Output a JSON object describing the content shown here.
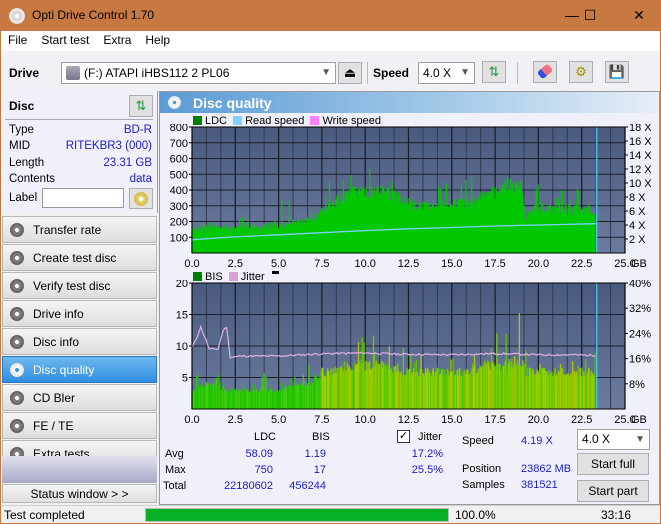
{
  "window": {
    "title": "Opti Drive Control 1.70",
    "minimize": "—",
    "maximize": "☐",
    "close": "✕"
  },
  "menu": [
    "File",
    "Start test",
    "Extra",
    "Help"
  ],
  "toolbar": {
    "drive_label": "Drive",
    "drive_value": "(F:)  ATAPI iHBS112  2 PL06",
    "speed_label": "Speed",
    "speed_value": "4.0 X",
    "icons": [
      "eject-icon",
      "refresh-icon",
      "erase-icon",
      "settings-icon",
      "save-icon"
    ]
  },
  "disc": {
    "header": "Disc",
    "type_label": "Type",
    "type_value": "BD-R",
    "mid_label": "MID",
    "mid_value": "RITEKBR3 (000)",
    "length_label": "Length",
    "length_value": "23.31 GB",
    "contents_label": "Contents",
    "contents_value": "data",
    "label_label": "Label",
    "label_value": ""
  },
  "nav": [
    {
      "label": "Transfer rate",
      "active": false
    },
    {
      "label": "Create test disc",
      "active": false
    },
    {
      "label": "Verify test disc",
      "active": false
    },
    {
      "label": "Drive info",
      "active": false
    },
    {
      "label": "Disc info",
      "active": false
    },
    {
      "label": "Disc quality",
      "active": true
    },
    {
      "label": "CD Bler",
      "active": false
    },
    {
      "label": "FE / TE",
      "active": false
    },
    {
      "label": "Extra tests",
      "active": false
    }
  ],
  "status_window_button": "Status window > >",
  "panel_title": "Disc quality",
  "colors": {
    "ldc": "#00c800",
    "read_speed": "#7fd0ff",
    "write_speed": "#ff80ff",
    "bis": "#00a000",
    "jitter": "#d8a0d8",
    "plot_bg": "#5a6a8a",
    "accent": "#2f8fe0"
  },
  "chart_data": [
    {
      "type": "area",
      "title": "LDC / Read speed",
      "legend": [
        "LDC",
        "Read speed",
        "Write speed"
      ],
      "legend_position": "top-left",
      "xlabel": "GB",
      "x_ticks": [
        "0.0",
        "2.5",
        "5.0",
        "7.5",
        "10.0",
        "12.5",
        "15.0",
        "17.5",
        "20.0",
        "22.5",
        "25.0"
      ],
      "xlim": [
        0,
        25
      ],
      "ylim_left": [
        0,
        800
      ],
      "y_ticks_left": [
        "100",
        "200",
        "300",
        "400",
        "500",
        "600",
        "700",
        "800"
      ],
      "ylim_right": [
        0,
        18
      ],
      "y_ticks_right": [
        "2 X",
        "4 X",
        "6 X",
        "8 X",
        "10 X",
        "12 X",
        "14 X",
        "16 X",
        "18 X"
      ],
      "grid": true,
      "series": [
        {
          "name": "LDC",
          "x": [
            0,
            1,
            2,
            2.5,
            3,
            4,
            5,
            6,
            7,
            7.5,
            8,
            9,
            10,
            11,
            12,
            13,
            14,
            15,
            16,
            17,
            17.5,
            18,
            19,
            19.3,
            19.5,
            20,
            21,
            22,
            23,
            23.31
          ],
          "values": [
            150,
            175,
            165,
            160,
            165,
            170,
            175,
            200,
            210,
            260,
            300,
            390,
            400,
            390,
            360,
            300,
            300,
            310,
            320,
            380,
            400,
            440,
            450,
            200,
            280,
            280,
            280,
            280,
            280,
            250
          ],
          "peaks": [
            170,
            200,
            190,
            165,
            290,
            200,
            340,
            340,
            350,
            470,
            580,
            600,
            550,
            550,
            500,
            420,
            450,
            450,
            520,
            520,
            600,
            700,
            750,
            400,
            450,
            460,
            430,
            420,
            420,
            400
          ]
        },
        {
          "name": "Read speed",
          "x": [
            0,
            2.5,
            5,
            7.5,
            10,
            12.5,
            15,
            17.5,
            20,
            22.5,
            23.31
          ],
          "values": [
            1.9,
            2.3,
            2.6,
            2.9,
            3.2,
            3.45,
            3.65,
            3.85,
            4.0,
            4.15,
            4.19
          ]
        }
      ],
      "end_marker_gb": 23.31
    },
    {
      "type": "area",
      "title": "BIS / Jitter",
      "legend": [
        "BIS",
        "Jitter"
      ],
      "legend_position": "top-left",
      "xlabel": "GB",
      "x_ticks": [
        "0.0",
        "2.5",
        "5.0",
        "7.5",
        "10.0",
        "12.5",
        "15.0",
        "17.5",
        "20.0",
        "22.5",
        "25.0"
      ],
      "xlim": [
        0,
        25
      ],
      "ylim_left": [
        0,
        20
      ],
      "y_ticks_left": [
        "5",
        "10",
        "15",
        "20"
      ],
      "ylim_right": [
        0,
        40
      ],
      "y_ticks_right": [
        "8%",
        "16%",
        "24%",
        "32%",
        "40%"
      ],
      "grid": true,
      "series": [
        {
          "name": "BIS",
          "x": [
            0,
            1,
            2,
            3,
            4,
            5,
            6,
            7,
            7.5,
            8,
            9,
            10,
            11,
            12,
            13,
            14,
            15,
            16,
            17,
            18,
            19,
            19.3,
            19.5,
            20,
            21,
            22,
            23,
            23.31
          ],
          "values": [
            3,
            4,
            3,
            3,
            3,
            3,
            4,
            4,
            6,
            6,
            7,
            7,
            7,
            6,
            6,
            6,
            6,
            6,
            7,
            7,
            8,
            6,
            6,
            6,
            6,
            6,
            6,
            6
          ],
          "peaks": [
            6,
            6,
            5,
            5,
            6,
            7,
            8,
            7,
            9,
            11,
            15,
            12,
            12,
            10,
            9,
            9,
            11,
            10,
            13,
            14,
            17,
            10,
            9,
            9,
            9,
            9,
            9,
            9
          ]
        },
        {
          "name": "Jitter",
          "x": [
            0,
            0.3,
            0.5,
            0.8,
            1,
            1.5,
            1.8,
            2,
            2.2,
            3,
            5,
            7,
            8,
            10,
            12,
            15,
            17.5,
            19,
            20,
            22,
            23.31
          ],
          "values": [
            19.5,
            23,
            26,
            22,
            19,
            19,
            25,
            26,
            16.5,
            16.8,
            16.8,
            17.4,
            17.6,
            17.8,
            17.4,
            17.2,
            17.6,
            17.4,
            17.2,
            17.2,
            17.0
          ]
        }
      ],
      "end_marker_gb": 23.31
    }
  ],
  "stats": {
    "col_ldc": "LDC",
    "col_bis": "BIS",
    "jitter_label": "Jitter",
    "jitter_checked": true,
    "avg_label": "Avg",
    "avg_ldc": "58.09",
    "avg_bis": "1.19",
    "avg_jitter": "17.2%",
    "max_label": "Max",
    "max_ldc": "750",
    "max_bis": "17",
    "max_jitter": "25.5%",
    "total_label": "Total",
    "total_ldc": "22180602",
    "total_bis": "456244",
    "speed_label": "Speed",
    "speed_value": "4.19 X",
    "position_label": "Position",
    "position_value": "23862 MB",
    "samples_label": "Samples",
    "samples_value": "381521",
    "speed_select": "4.0 X",
    "start_full": "Start full",
    "start_part": "Start part"
  },
  "status": {
    "text": "Test completed",
    "progress": 100.0,
    "progress_text": "100.0%",
    "time": "33:16"
  }
}
